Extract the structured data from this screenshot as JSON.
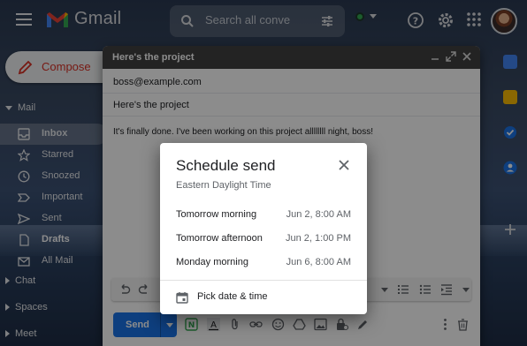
{
  "app": {
    "name": "Gmail"
  },
  "search": {
    "placeholder": "Search all conve"
  },
  "compose_button": {
    "label": "Compose"
  },
  "nav": {
    "section_mail": "Mail",
    "items": [
      {
        "label": "Inbox",
        "icon": "inbox-icon",
        "active": true
      },
      {
        "label": "Starred",
        "icon": "star-icon"
      },
      {
        "label": "Snoozed",
        "icon": "clock-icon"
      },
      {
        "label": "Important",
        "icon": "label-important-icon"
      },
      {
        "label": "Sent",
        "icon": "send-icon"
      },
      {
        "label": "Drafts",
        "icon": "draft-icon",
        "bold": true
      },
      {
        "label": "All Mail",
        "icon": "all-mail-icon"
      }
    ],
    "section_chat": "Chat",
    "section_spaces": "Spaces",
    "section_meet": "Meet"
  },
  "compose_window": {
    "title": "Here's the project",
    "to": "boss@example.com",
    "subject": "Here's the project",
    "body": "It's finally done. I've been working on this project allllllll night, boss!",
    "send_label": "Send"
  },
  "schedule_dialog": {
    "title": "Schedule send",
    "timezone": "Eastern Daylight Time",
    "options": [
      {
        "label": "Tomorrow morning",
        "value": "Jun 2, 8:00 AM"
      },
      {
        "label": "Tomorrow afternoon",
        "value": "Jun 2, 1:00 PM"
      },
      {
        "label": "Monday morning",
        "value": "Jun 6, 8:00 AM"
      }
    ],
    "pick_label": "Pick date & time"
  },
  "colors": {
    "accent": "#1a73e8",
    "compose_text": "#d93025",
    "status": "#34a853"
  }
}
